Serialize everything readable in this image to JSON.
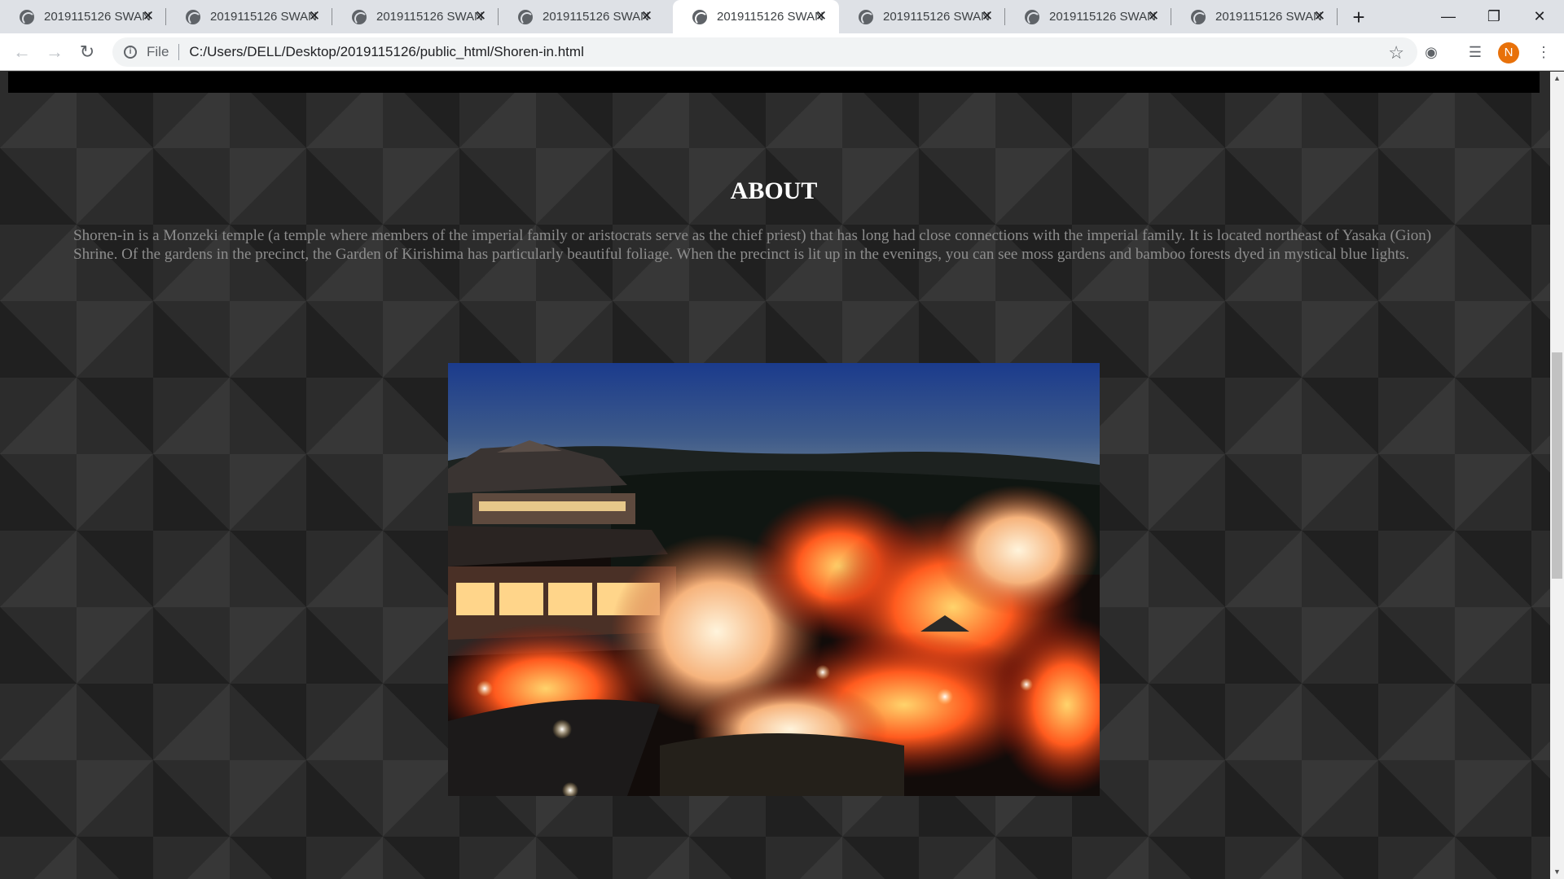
{
  "browser": {
    "tabs": [
      {
        "title": "2019115126 SWAN",
        "active": false
      },
      {
        "title": "2019115126 SWAN",
        "active": false
      },
      {
        "title": "2019115126 SWAN",
        "active": false
      },
      {
        "title": "2019115126 SWAN",
        "active": false
      },
      {
        "title": "2019115126 SWAN",
        "active": true
      },
      {
        "title": "2019115126 SWAN",
        "active": false
      },
      {
        "title": "2019115126 SWAN",
        "active": false
      },
      {
        "title": "2019115126 SWAN",
        "active": false
      }
    ],
    "address": {
      "scheme_label": "File",
      "url": "C:/Users/DELL/Desktop/2019115126/public_html/Shoren-in.html"
    },
    "profile_initial": "N",
    "icons": {
      "back": "arrow-left-icon",
      "forward": "arrow-right-icon",
      "reload": "reload-icon",
      "info": "info-icon",
      "bookmark": "star-icon",
      "camera": "camera-icon",
      "media": "media-control-icon",
      "menu": "kebab-menu-icon"
    }
  },
  "page": {
    "about": {
      "heading": "ABOUT",
      "body": "Shoren-in is a Monzeki temple (a temple where members of the imperial family or aristocrats serve as the chief priest) that has long had close connections with the imperial family. It is located northeast of Yasaka (Gion) Shrine. Of the gardens in the precinct, the Garden of Kirishima has particularly beautiful foliage. When the precinct is lit up in the evenings, you can see moss gardens and bamboo forests dyed in mystical blue lights."
    },
    "colors": {
      "background": "#2c2c2c",
      "heading": "#ffffff",
      "body_text": "#8d8d8d",
      "top_bar": "#000000"
    }
  }
}
